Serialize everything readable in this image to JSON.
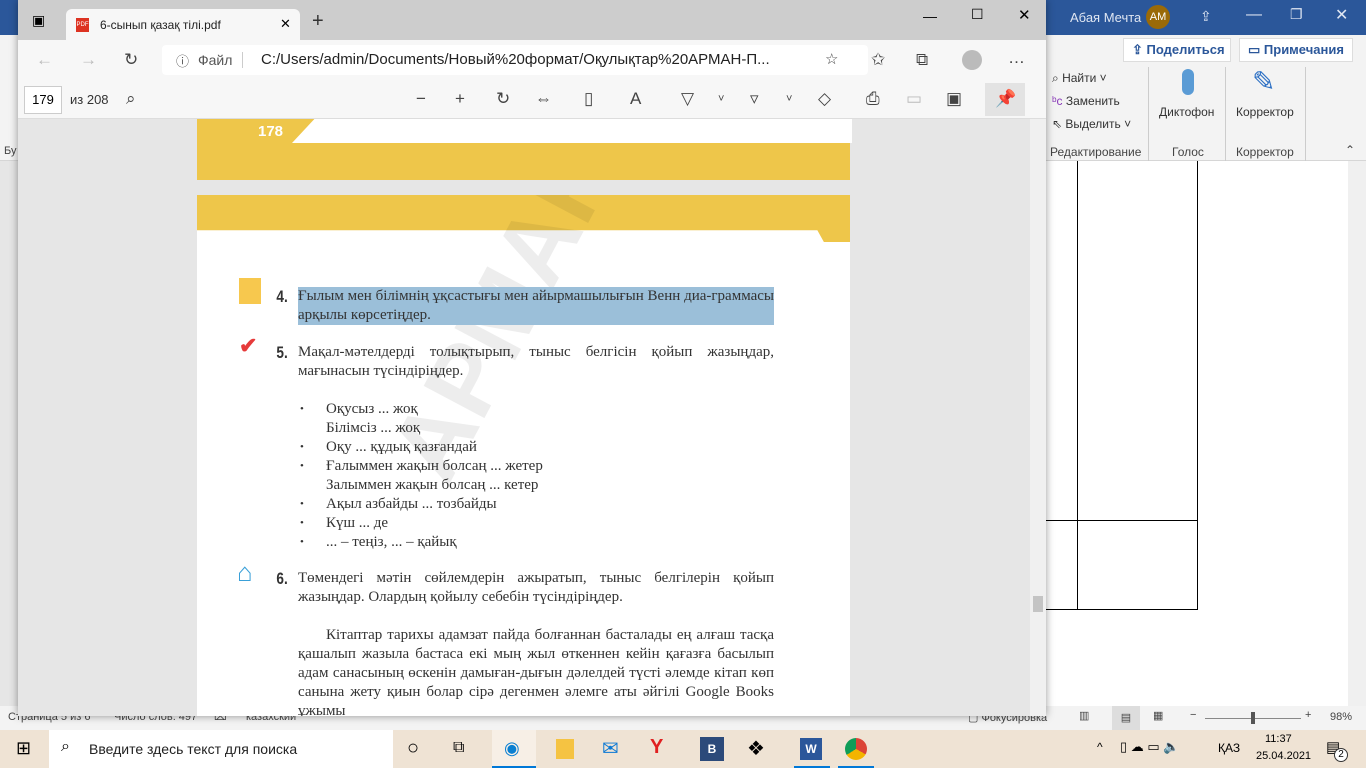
{
  "word": {
    "user": "Абая Мечта",
    "avatar": "АМ",
    "share": "Поделиться",
    "comments": "Примечания",
    "find": "Найти",
    "replace": "Заменить",
    "select": "Выделить",
    "group_edit": "Редактирование",
    "dictate": "Диктофон",
    "group_voice": "Голос",
    "editor": "Корректор",
    "group_editor": "Корректор",
    "left_clip": "Бу",
    "status": {
      "page": "Страница 5 из 6",
      "words": "Число слов: 497",
      "lang": "казахский",
      "focus": "Фокусировка",
      "zoom": "98%",
      "zoom_level": 0.49
    }
  },
  "edge": {
    "tab_title": "6-сынып қазақ тілі.pdf",
    "file_label": "Файл",
    "url": "C:/Users/admin/Documents/Новый%20формат/Оқулықтар%20АРМАН-П...",
    "page_input": "179",
    "page_total": "из 208"
  },
  "pdf": {
    "page_number": "178",
    "watermark": "АРМАН-ПВ баспасы",
    "task4": {
      "num": "4.",
      "text": "Ғылым мен білімнің ұқсастығы мен айырмашылығын Венн диа-граммасы арқылы көрсетіңдер."
    },
    "task5": {
      "num": "5.",
      "text": "Мақал-мәтелдерді толықтырып, тыныс белгісін қойып жазыңдар, мағынасын түсіндіріңдер.",
      "items": [
        {
          "bullet": true,
          "text": "Оқусыз ... жоқ"
        },
        {
          "bullet": false,
          "text": "Білімсіз ... жоқ"
        },
        {
          "bullet": true,
          "text": "Оқу ... құдық қазғандай"
        },
        {
          "bullet": true,
          "text": "Ғалыммен жақын болсаң ... жетер"
        },
        {
          "bullet": false,
          "text": "Залыммен жақын болсаң ... кетер"
        },
        {
          "bullet": true,
          "text": "Ақыл азбайды ... тозбайды"
        },
        {
          "bullet": true,
          "text": "Күш ... де"
        },
        {
          "bullet": true,
          "text": "... – теңіз, ... – қайық"
        }
      ]
    },
    "task6": {
      "num": "6.",
      "text": "Төмендегі мәтін сөйлемдерін ажыратып, тыныс белгілерін қойып жазыңдар. Олардың қойылу себебін түсіндіріңдер."
    },
    "paragraph": "Кітаптар тарихы адамзат пайда болғаннан басталады ең алғаш тасқа қашалып жазыла бастаса екі мың жыл өткеннен кейін қағазға басылып адам санасының өскенін дамыған-дығын дәлелдей түсті әлемде кітап көп санына жету қиын болар сірә дегенмен әлемге аты әйгілі Google Books ұжымы"
  },
  "taskbar": {
    "search_placeholder": "Введите здесь текст для поиска",
    "lang": "ҚАЗ",
    "time": "11:37",
    "date": "25.04.2021",
    "notifications": "2"
  },
  "colors": {
    "word_blue": "#2b579a",
    "pdf_yellow": "#eec64a",
    "highlight": "#9bbfd9"
  }
}
